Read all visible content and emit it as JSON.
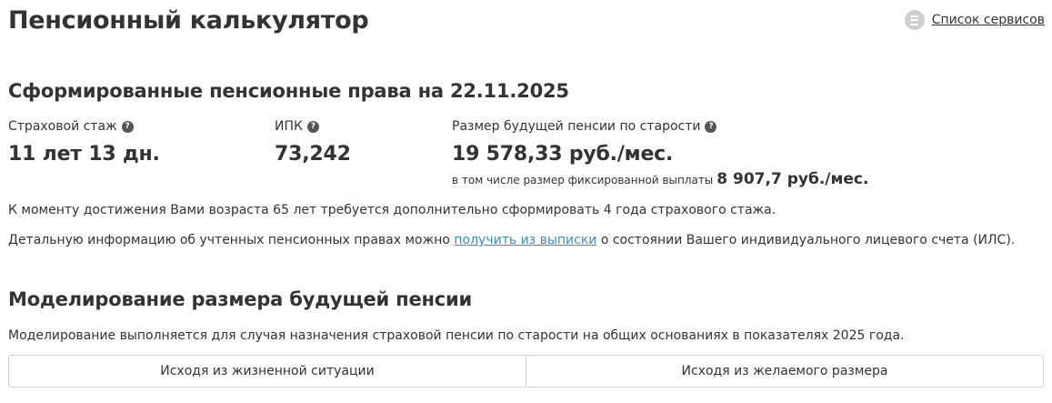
{
  "header": {
    "title": "Пенсионный калькулятор",
    "services_link": "Список сервисов",
    "services_icon": "list-icon"
  },
  "rights": {
    "title": "Сформированные пенсионные права на 22.11.2025",
    "stats": [
      {
        "label": "Страховой стаж",
        "value": "11 лет 13 дн."
      },
      {
        "label": "ИПК",
        "value": "73,242"
      },
      {
        "label": "Размер будущей пенсии по старости",
        "value": "19 578,33 руб./мес."
      }
    ],
    "fixed_text": "в том числе размер фиксированной выплаты",
    "fixed_value": "8 907,7 руб./мес.",
    "requirement": "К моменту достижения Вами возраста 65 лет требуется дополнительно сформировать 4 года страхового стажа.",
    "details_before": "Детальную информацию об учтенных пенсионных правах можно",
    "details_link": "получить из выписки",
    "details_after": "о состоянии Вашего индивидуального лицевого счета (ИЛС)."
  },
  "modeling": {
    "title": "Моделирование размера будущей пенсии",
    "description": "Моделирование выполняется для случая назначения страховой пенсии по старости на общих основаниях в показателях 2025 года.",
    "tabs": [
      "Исходя из жизненной ситуации",
      "Исходя из желаемого размера"
    ]
  }
}
